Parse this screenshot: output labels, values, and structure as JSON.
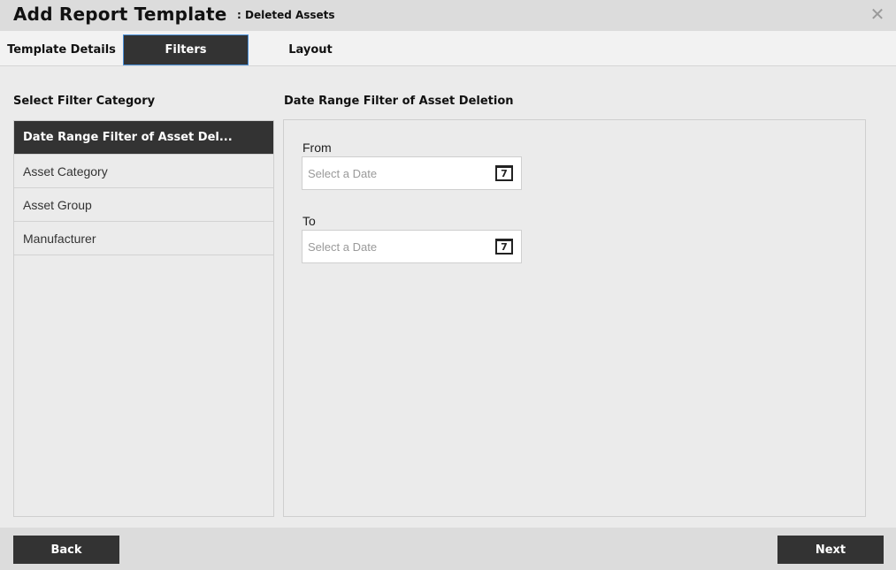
{
  "header": {
    "title": "Add Report Template",
    "subtitle": ": Deleted Assets",
    "close_icon": "close-icon"
  },
  "tabs": [
    {
      "label": "Template Details",
      "active": false
    },
    {
      "label": "Filters",
      "active": true
    },
    {
      "label": "Layout",
      "active": false
    }
  ],
  "category_panel": {
    "heading": "Select Filter Category",
    "items": [
      {
        "label": "Date Range Filter of Asset Del...",
        "active": true
      },
      {
        "label": "Asset Category",
        "active": false
      },
      {
        "label": "Asset Group",
        "active": false
      },
      {
        "label": "Manufacturer",
        "active": false
      }
    ]
  },
  "filter_panel": {
    "heading": "Date Range Filter of Asset Deletion",
    "from": {
      "label": "From",
      "placeholder": "Select a Date",
      "value": "",
      "icon": "calendar-icon",
      "icon_text": "7"
    },
    "to": {
      "label": "To",
      "placeholder": "Select a Date",
      "value": "",
      "icon": "calendar-icon",
      "icon_text": "7"
    }
  },
  "footer": {
    "back_label": "Back",
    "next_label": "Next"
  },
  "colors": {
    "accent_dark": "#333333",
    "active_tab_border": "#4a90d9",
    "background": "#ebebeb",
    "header_bg": "#dcdcdc"
  }
}
